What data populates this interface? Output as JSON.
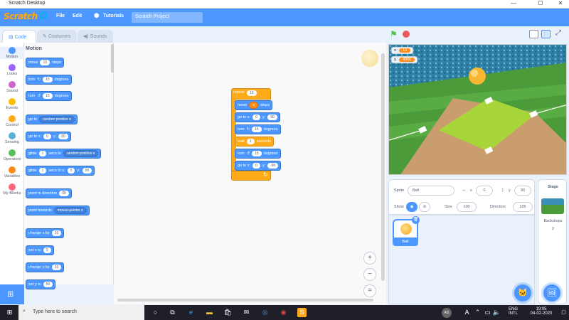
{
  "window": {
    "title": "Scratch Desktop",
    "minimize": "—",
    "maximize": "☐",
    "close": "✕"
  },
  "menu": {
    "logo": "Scratch",
    "globe": "🌐",
    "file": "File",
    "edit": "Edit",
    "tutorials": "Tutorials",
    "project_title": "Scratch Project"
  },
  "tabs": {
    "code": "Code",
    "costumes": "Costumes",
    "sounds": "Sounds"
  },
  "categories": [
    {
      "label": "Motion",
      "color": "#4c97ff"
    },
    {
      "label": "Looks",
      "color": "#9966ff"
    },
    {
      "label": "Sound",
      "color": "#cf63cf"
    },
    {
      "label": "Events",
      "color": "#ffbf00"
    },
    {
      "label": "Control",
      "color": "#ffab19"
    },
    {
      "label": "Sensing",
      "color": "#5cb1d6"
    },
    {
      "label": "Operators",
      "color": "#59c059"
    },
    {
      "label": "Variables",
      "color": "#ff8c1a"
    },
    {
      "label": "My Blocks",
      "color": "#ff6680"
    }
  ],
  "palette": {
    "title": "Motion",
    "move": {
      "pre": "move",
      "val": "10",
      "post": "steps"
    },
    "turn_right": {
      "pre": "turn",
      "icon": "↻",
      "val": "15",
      "post": "degrees"
    },
    "turn_left": {
      "pre": "turn",
      "icon": "↺",
      "val": "15",
      "post": "degrees"
    },
    "goto_random": {
      "pre": "go to",
      "dd": "random position ▾"
    },
    "goto_xy": {
      "pre": "go to x:",
      "x": "0",
      "ylbl": "y:",
      "y": "90"
    },
    "glide_random": {
      "pre": "glide",
      "val": "1",
      "mid": "secs to",
      "dd": "random position ▾"
    },
    "glide_xy": {
      "pre": "glide",
      "val": "1",
      "mid": "secs to x:",
      "x": "0",
      "ylbl": "y:",
      "y": "90"
    },
    "point_dir": {
      "pre": "point in direction",
      "val": "90"
    },
    "point_towards": {
      "pre": "point towards",
      "dd": "mouse-pointer ▾"
    },
    "change_x": {
      "pre": "change x by",
      "val": "10"
    },
    "set_x": {
      "pre": "set x to",
      "val": "0"
    },
    "change_y": {
      "pre": "change y by",
      "val": "10"
    },
    "set_y": {
      "pre": "set y to",
      "val": "50"
    }
  },
  "script": {
    "repeat": {
      "pre": "repeat",
      "val": "10"
    },
    "move": {
      "pre": "move",
      "val": "x",
      "post": "steps"
    },
    "goto1": {
      "pre": "go to x:",
      "x": "0",
      "ylbl": "y:",
      "y": "90"
    },
    "turn1": {
      "pre": "turn",
      "icon": "↻",
      "val": "15",
      "post": "degrees"
    },
    "wait": {
      "pre": "wait",
      "val": "1",
      "post": "seconds"
    },
    "turn2": {
      "pre": "turn",
      "icon": "↺",
      "val": "15",
      "post": "degrees"
    },
    "goto2": {
      "pre": "go to x:",
      "x": "0",
      "ylbl": "y:",
      "y": "-90"
    },
    "loop_arrow": "↻"
  },
  "zoom": {
    "in": "+",
    "out": "−",
    "reset": "="
  },
  "stage": {
    "monitor_x_label": "x",
    "monitor_x_value": "10",
    "monitor_y_label": "y",
    "monitor_y_value": "4900"
  },
  "sprite_info": {
    "sprite_label": "Sprite",
    "sprite_name": "Ball",
    "x_icon": "↔",
    "x_label": "x",
    "x_value": "0",
    "y_icon": "↕",
    "y_label": "y",
    "y_value": "90",
    "show_label": "Show",
    "size_label": "Size",
    "size_value": "100",
    "direction_label": "Direction",
    "direction_value": "105"
  },
  "sprites": [
    {
      "name": "Ball"
    }
  ],
  "stage_panel": {
    "title": "Stage",
    "backdrops_label": "Backdrops",
    "backdrops_count": "2"
  },
  "taskbar": {
    "search_placeholder": "Type here to search",
    "lang1": "ENG",
    "lang2": "INTL",
    "time": "19:05",
    "date": "04-02-2020",
    "avatar": "AS"
  }
}
